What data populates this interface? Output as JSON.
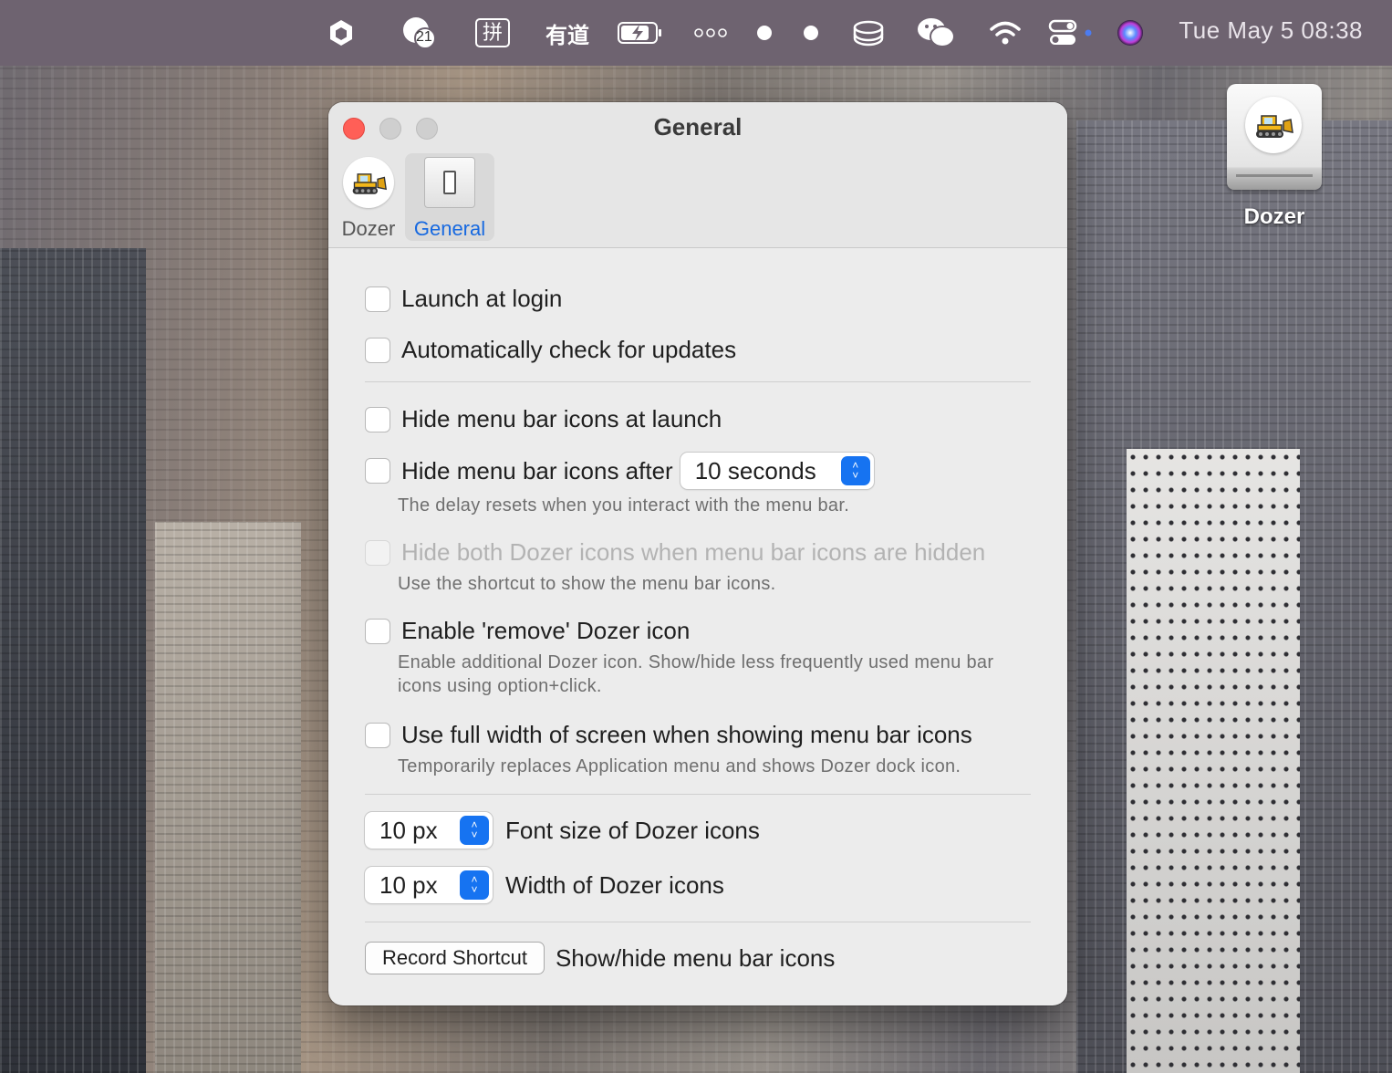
{
  "menubar": {
    "notification_count": "21",
    "pinyin_icon_text": "拼",
    "youdao_text": "有道",
    "datetime": "Tue May 5  08:38"
  },
  "desktop": {
    "drive_label": "Dozer"
  },
  "window": {
    "title": "General",
    "tabs": [
      {
        "label": "Dozer",
        "icon": "dozer-app-icon"
      },
      {
        "label": "General",
        "icon": "switch-icon",
        "selected": true
      }
    ],
    "launch_at_login": {
      "label": "Launch at login",
      "checked": false
    },
    "auto_updates": {
      "label": "Automatically check for updates",
      "checked": false
    },
    "hide_at_launch": {
      "label": "Hide menu bar icons at launch",
      "checked": false
    },
    "hide_after": {
      "label": "Hide menu bar icons after",
      "checked": false,
      "value": "10 seconds",
      "hint": "The delay resets when you interact with the menu bar."
    },
    "hide_both": {
      "label": "Hide both Dozer icons when menu bar icons are hidden",
      "checked": false,
      "disabled": true,
      "hint": "Use the shortcut to show the menu bar icons."
    },
    "remove_icon": {
      "label": "Enable 'remove' Dozer icon",
      "checked": false,
      "hint_line1": "Enable additional Dozer icon. Show/hide less frequently used menu bar",
      "hint_line2": "icons using option+click."
    },
    "full_width": {
      "label": "Use full width of screen when showing menu bar icons",
      "checked": false,
      "hint": "Temporarily replaces Application menu and shows Dozer dock icon."
    },
    "font_size": {
      "value": "10 px",
      "label": "Font size of Dozer icons"
    },
    "icon_width": {
      "value": "10 px",
      "label": "Width of Dozer icons"
    },
    "shortcut": {
      "button": "Record Shortcut",
      "label": "Show/hide menu bar icons"
    }
  },
  "colors": {
    "accent": "#1673f1",
    "close": "#ff5f57",
    "menubar": "#6e6370"
  }
}
